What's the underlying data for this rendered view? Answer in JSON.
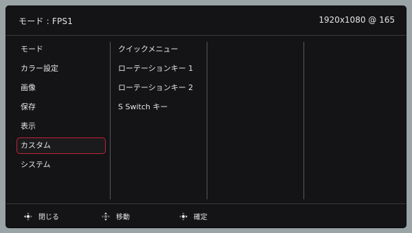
{
  "header": {
    "mode_label": "モード : FPS1",
    "resolution": "1920x1080 @ 165"
  },
  "menu": {
    "items": [
      {
        "label": "モード"
      },
      {
        "label": "カラー設定"
      },
      {
        "label": "画像"
      },
      {
        "label": "保存"
      },
      {
        "label": "表示"
      },
      {
        "label": "カスタム",
        "selected": true
      },
      {
        "label": "システム"
      }
    ]
  },
  "submenu": {
    "items": [
      {
        "label": "クイックメニュー"
      },
      {
        "label": "ローテーションキー 1"
      },
      {
        "label": "ローテーションキー 2"
      },
      {
        "label": "S Switch キー"
      }
    ]
  },
  "footer": {
    "close_label": "閉じる",
    "move_label": "移動",
    "confirm_label": "確定"
  },
  "colors": {
    "selection_border": "#c0233a",
    "panel_bg": "#141416",
    "text": "#e6e6e6"
  }
}
